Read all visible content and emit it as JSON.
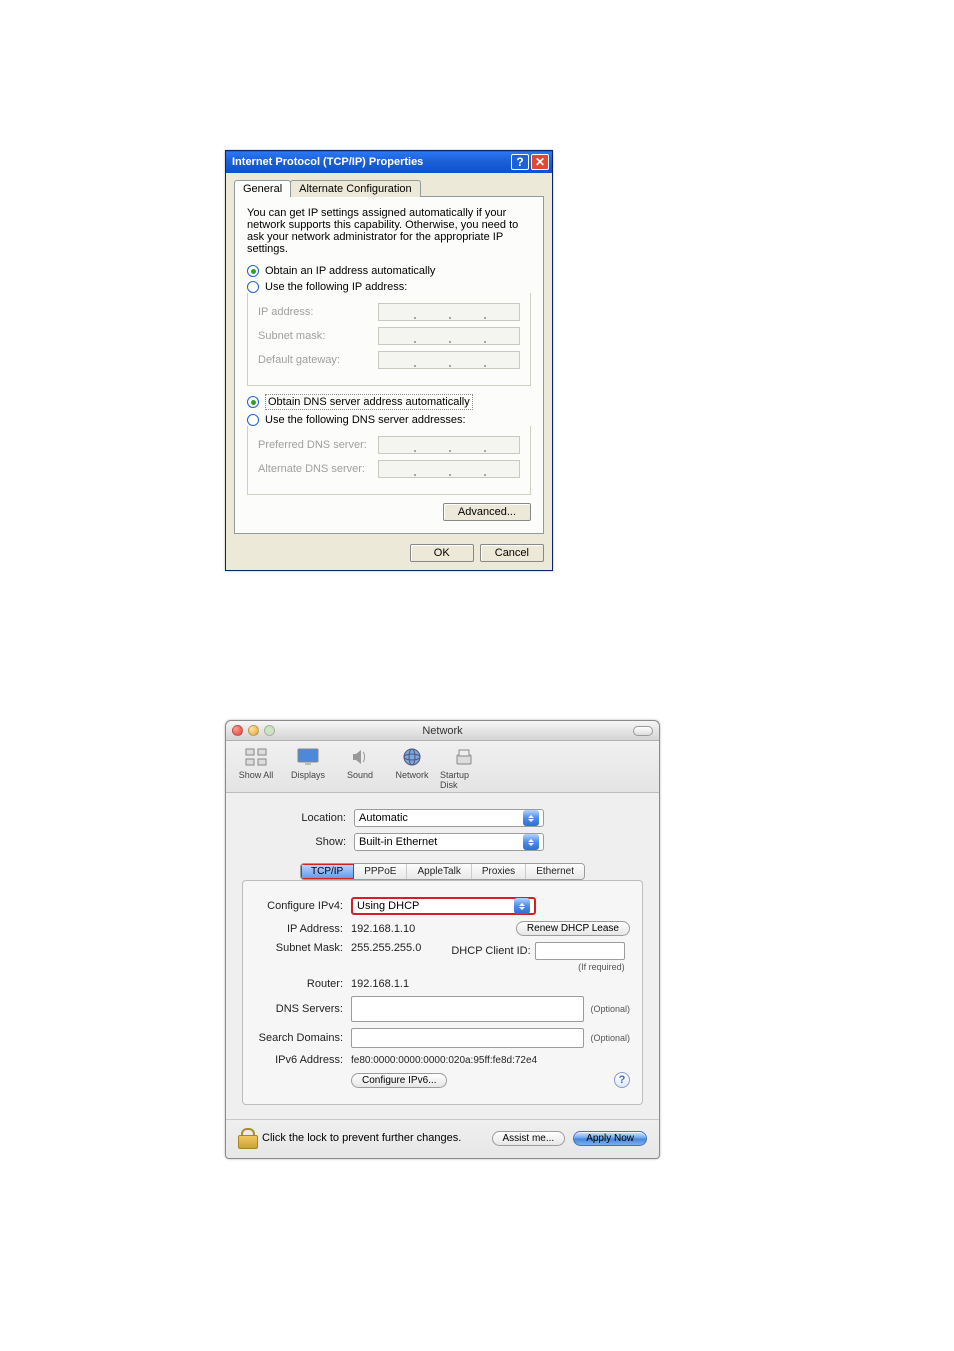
{
  "xp": {
    "title": "Internet Protocol (TCP/IP) Properties",
    "tabs": [
      "General",
      "Alternate Configuration"
    ],
    "blurb": "You can get IP settings assigned automatically if your network supports this capability. Otherwise, you need to ask your network administrator for the appropriate IP settings.",
    "radio_obtain_ip": "Obtain an IP address automatically",
    "radio_use_ip": "Use the following IP address:",
    "lbl_ip": "IP address:",
    "lbl_subnet": "Subnet mask:",
    "lbl_gateway": "Default gateway:",
    "radio_obtain_dns": "Obtain DNS server address automatically",
    "radio_use_dns": "Use the following DNS server addresses:",
    "lbl_pref_dns": "Preferred DNS server:",
    "lbl_alt_dns": "Alternate DNS server:",
    "btn_advanced": "Advanced...",
    "btn_ok": "OK",
    "btn_cancel": "Cancel"
  },
  "mac": {
    "title": "Network",
    "toolbar": {
      "show_all": "Show All",
      "displays": "Displays",
      "sound": "Sound",
      "network": "Network",
      "startup": "Startup Disk"
    },
    "lbl_location": "Location:",
    "val_location": "Automatic",
    "lbl_show": "Show:",
    "val_show": "Built-in Ethernet",
    "tabs": [
      "TCP/IP",
      "PPPoE",
      "AppleTalk",
      "Proxies",
      "Ethernet"
    ],
    "lbl_configure": "Configure IPv4:",
    "val_configure": "Using DHCP",
    "lbl_ip": "IP Address:",
    "val_ip": "192.168.1.10",
    "btn_renew": "Renew DHCP Lease",
    "lbl_subnet": "Subnet Mask:",
    "val_subnet": "255.255.255.0",
    "lbl_dhcp_client": "DHCP Client ID:",
    "txt_if_required": "(If required)",
    "lbl_router": "Router:",
    "val_router": "192.168.1.1",
    "lbl_dns": "DNS Servers:",
    "txt_optional": "(Optional)",
    "lbl_search": "Search Domains:",
    "lbl_ipv6": "IPv6 Address:",
    "val_ipv6": "fe80:0000:0000:0000:020a:95ff:fe8d:72e4",
    "btn_configure_ipv6": "Configure IPv6...",
    "footer_text": "Click the lock to prevent further changes.",
    "btn_assist": "Assist me...",
    "btn_apply": "Apply Now"
  }
}
